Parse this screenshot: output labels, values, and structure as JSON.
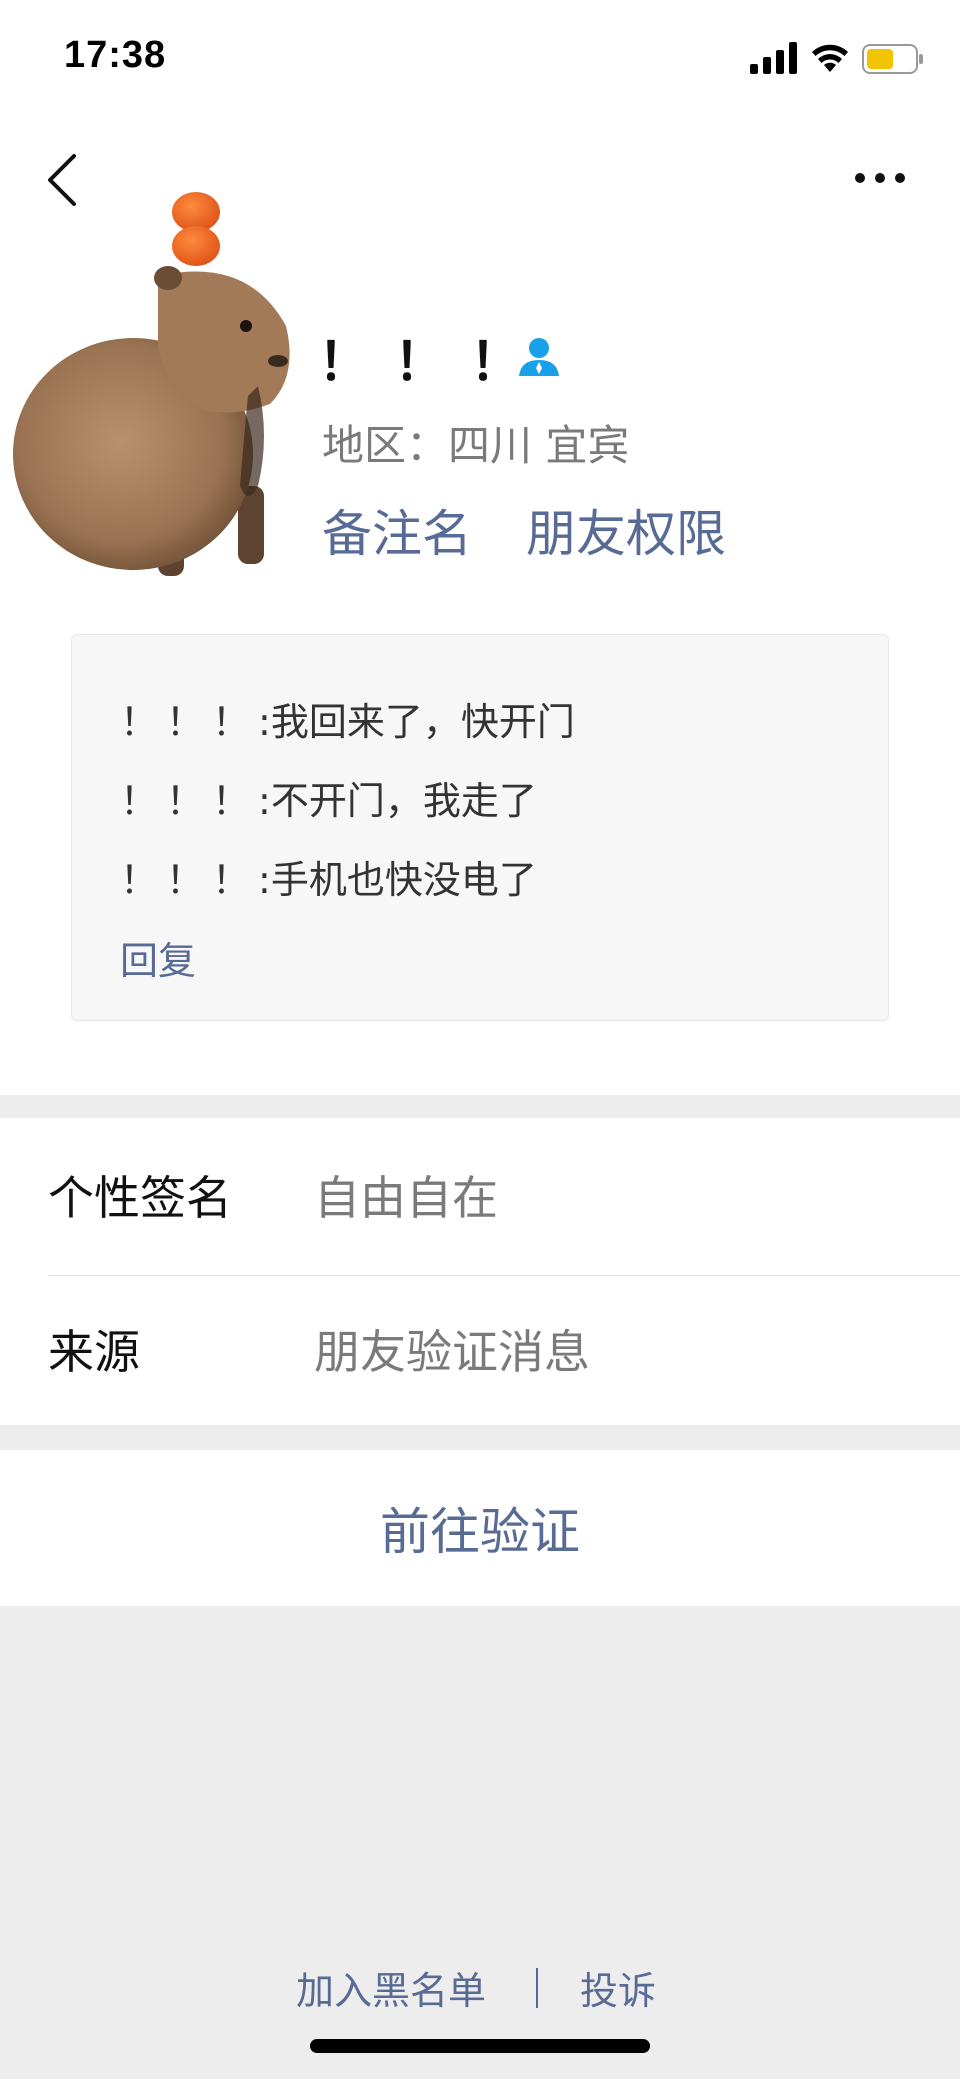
{
  "status_bar": {
    "time": "17:38",
    "battery_color": "#f2c300"
  },
  "nav": {
    "back_icon": "chevron-left-icon",
    "more_icon": "more-dots-icon"
  },
  "profile": {
    "nickname": "！！！",
    "verified_icon": "contact-person-icon",
    "region": "地区：四川 宜宾",
    "remark_label": "备注名",
    "permission_label": "朋友权限"
  },
  "messages": [
    {
      "sender": "！！！",
      "separator": ":",
      "text": "我回来了，快开门"
    },
    {
      "sender": "！！！",
      "separator": ":",
      "text": "不开门，我走了"
    },
    {
      "sender": "！！！",
      "separator": ":",
      "text": "手机也快没电了"
    }
  ],
  "reply_label": "回复",
  "info": {
    "signature_label": "个性签名",
    "signature_value": "自由自在",
    "source_label": "来源",
    "source_value": "朋友验证消息"
  },
  "action": {
    "verify_label": "前往验证"
  },
  "footer": {
    "blacklist_label": "加入黑名单",
    "separator": "|",
    "report_label": "投诉"
  },
  "colors": {
    "link": "#576b95",
    "background": "#ededed",
    "card": "#ffffff",
    "secondary_text": "#7a7a7a"
  }
}
